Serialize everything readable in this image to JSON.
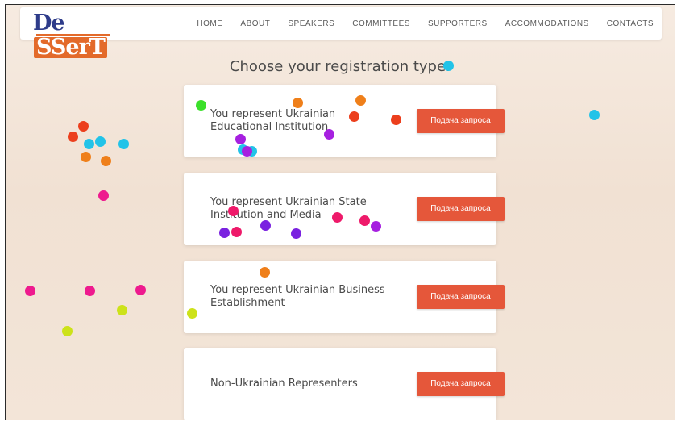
{
  "logo": {
    "part1": "De",
    "part2": "SSerT"
  },
  "nav": {
    "items": [
      "HOME",
      "ABOUT",
      "SPEAKERS",
      "COMMITTEES",
      "SUPPORTERS",
      "ACCOMMODATIONS",
      "CONTACTS"
    ]
  },
  "heading": "Choose your registration type:",
  "cards": [
    {
      "label": "You represent Ukrainian Educational Institution",
      "button": "Подача запроса"
    },
    {
      "label": "You represent Ukrainian State Institution and Media",
      "button": "Подача запроса"
    },
    {
      "label": "You represent Ukrainian Business Establishment",
      "button": "Подача запроса"
    },
    {
      "label": "Non-Ukrainian Representers",
      "button": "Подача запроса"
    }
  ],
  "colors": {
    "accent": "#e5573a",
    "logo_blue": "#2e3c8a",
    "logo_orange": "#e36a2a"
  }
}
